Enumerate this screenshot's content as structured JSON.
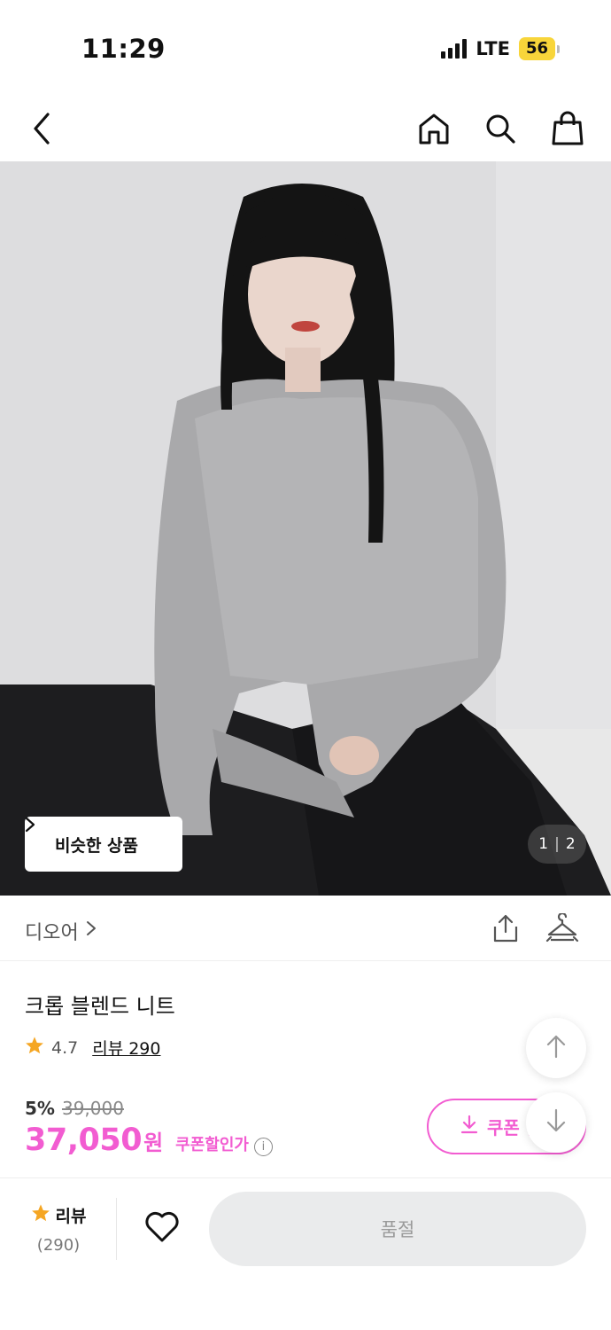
{
  "status_bar": {
    "time": "11:29",
    "network": "LTE",
    "battery": "56"
  },
  "nav": {
    "icons": [
      "back-icon",
      "home-icon",
      "search-icon",
      "shopping-bag-icon"
    ]
  },
  "hero": {
    "similar_label": "비슷한 상품",
    "page_current": "1",
    "page_total": "2"
  },
  "brand": {
    "name": "디오어",
    "icons": [
      "share-icon",
      "hanger-icon"
    ]
  },
  "product": {
    "title": "크롭 블렌드 니트",
    "rating": "4.7",
    "review_link": "리뷰 290",
    "discount_rate": "5%",
    "original_price": "39,000",
    "final_price": "37,050",
    "final_unit": "원",
    "coupon_label": "쿠폰할인가",
    "coupon_button": "쿠폰 받"
  },
  "bottom": {
    "review_label": "리뷰",
    "review_count": "(290)",
    "soldout_label": "품절"
  },
  "colors": {
    "accent": "#f25cd1",
    "star": "#f5a623",
    "battery": "#f8d53a"
  }
}
